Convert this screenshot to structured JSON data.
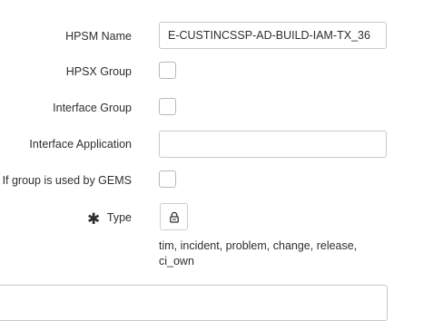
{
  "form": {
    "hpsm_name": {
      "label": "HPSM Name",
      "value": "E-CUSTINCSSP-AD-BUILD-IAM-TX_36"
    },
    "hpsx_group": {
      "label": "HPSX Group",
      "checked": false
    },
    "interface_group": {
      "label": "Interface Group",
      "checked": false
    },
    "interface_application": {
      "label": "Interface Application",
      "value": ""
    },
    "used_by_gems": {
      "label": "If group is used by GEMS",
      "checked": false
    },
    "type": {
      "label": "Type",
      "required": true,
      "required_symbol": "✱",
      "lock_icon": "lock-icon",
      "value_line1": "tim, incident, problem, change, release,",
      "value_line2": "ci_own"
    },
    "bottom_field": {
      "value": ""
    }
  }
}
